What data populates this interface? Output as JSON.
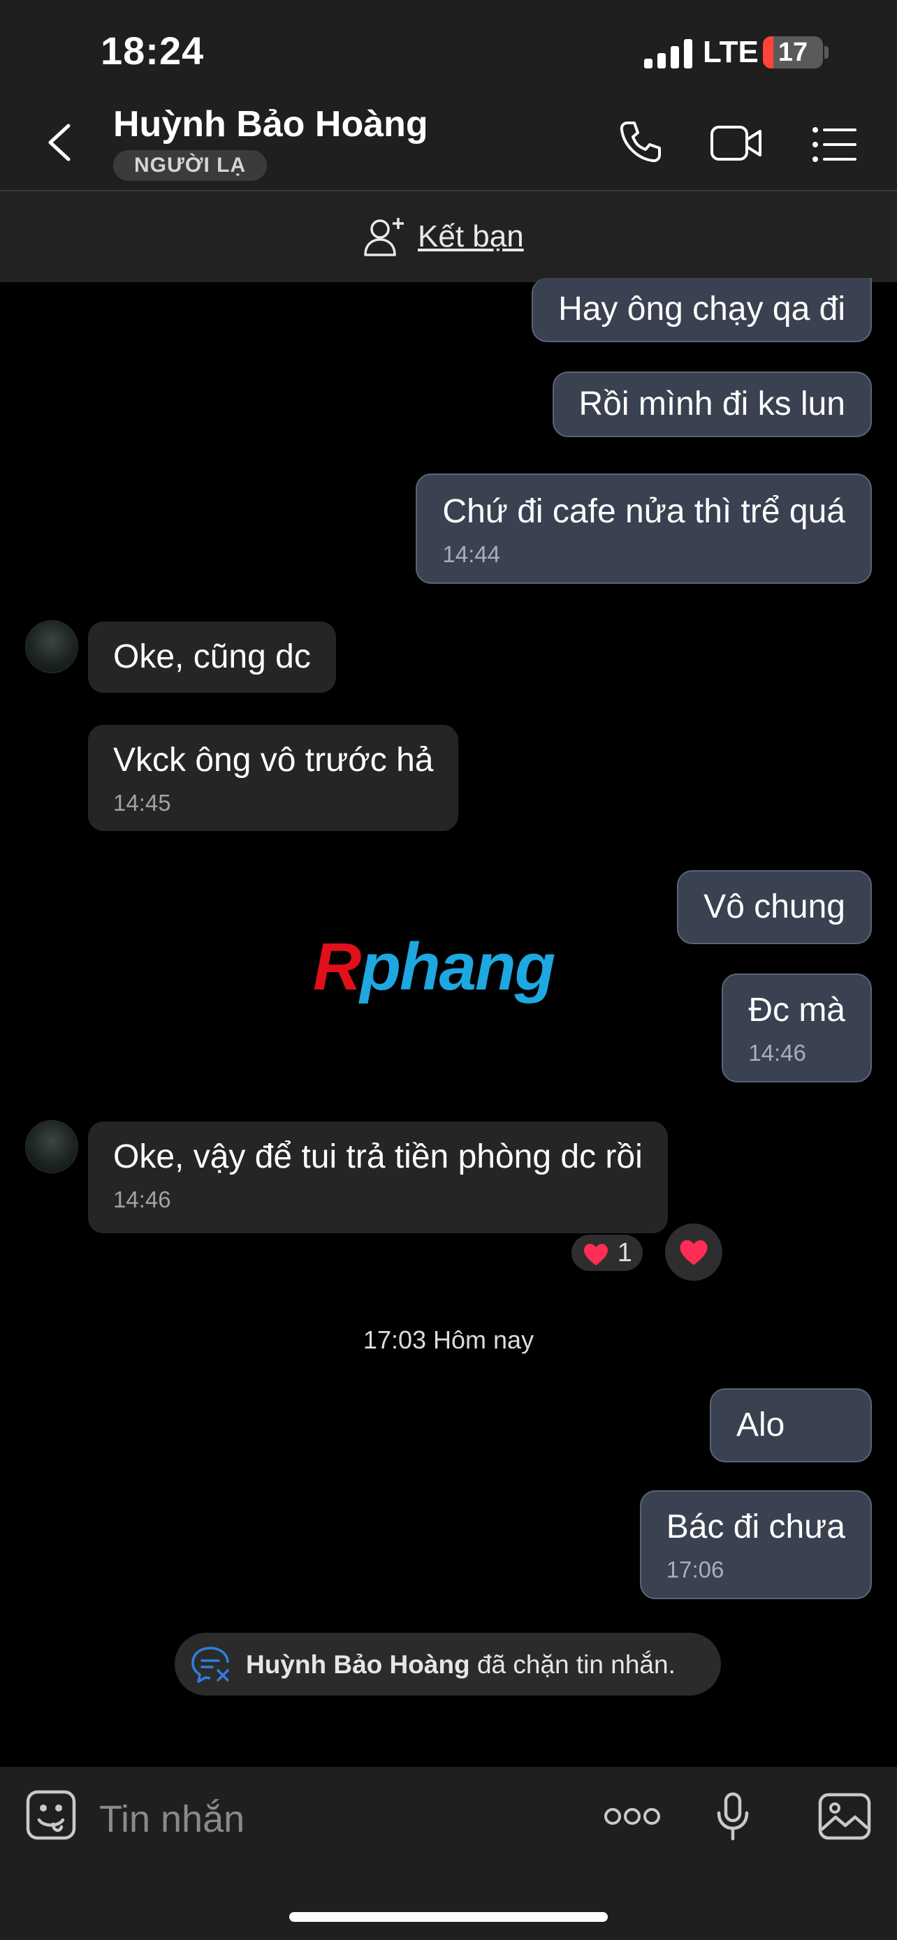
{
  "status_bar": {
    "time": "18:24",
    "network": "LTE",
    "battery": "17",
    "battery_level": 0.17
  },
  "header": {
    "contact_name": "Huỳnh Bảo Hoàng",
    "badge": "NGƯỜI LẠ",
    "icons": [
      "back-icon",
      "phone-icon",
      "video-call-icon",
      "menu-list-icon"
    ]
  },
  "friend_bar": {
    "label": "Kết bạn",
    "icon": "add-person-icon"
  },
  "messages": {
    "m1": {
      "text": "Hay ông chạy qa đi"
    },
    "m2": {
      "text": "Rồi mình đi ks lun"
    },
    "m3": {
      "text": "Chứ đi cafe nửa thì trể quá",
      "time": "14:44"
    },
    "m4": {
      "text": "Oke, cũng dc"
    },
    "m5": {
      "text": "Vkck ông vô trước hả",
      "time": "14:45"
    },
    "m6": {
      "text": "Vô chung"
    },
    "m7": {
      "text": "Đc mà",
      "time": "14:46"
    },
    "m8": {
      "text": "Oke, vậy để tui trả tiền phòng dc rồi",
      "time": "14:46",
      "reaction_count": "1"
    },
    "m9": {
      "text": "Alo"
    },
    "m10": {
      "text": "Bác đi chưa",
      "time": "17:06"
    }
  },
  "watermark": {
    "first": "R",
    "rest": "phang"
  },
  "day_separator": "17:03 Hôm nay",
  "block_notice": {
    "name": "Huỳnh Bảo Hoàng",
    "text": " đã chặn tin nhắn."
  },
  "composer": {
    "placeholder": "Tin nhắn",
    "icons": [
      "sticker-icon",
      "more-icon",
      "microphone-icon",
      "image-icon"
    ]
  },
  "colors": {
    "header_bg": "#1f1f1f",
    "outgoing_bubble": "#3a4150",
    "incoming_bubble": "#252525",
    "battery_low": "#ff453a",
    "reaction_heart": "#ff2d55"
  }
}
